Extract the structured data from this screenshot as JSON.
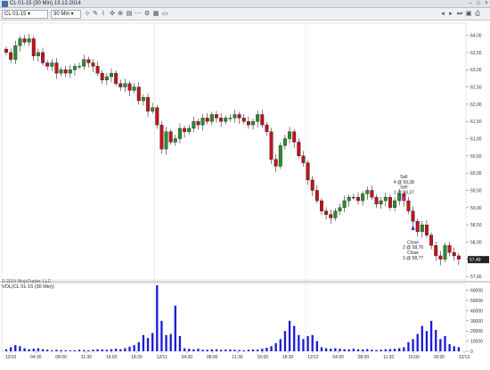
{
  "window": {
    "title": "CL 01-15 (30 Min)  13.12.2014"
  },
  "toolbar": {
    "instrument": "CL 01-15",
    "interval": "30 Min"
  },
  "price_axis": {
    "labels": [
      "64,00",
      "63,50",
      "63,00",
      "62,50",
      "62,00",
      "61,50",
      "61,00",
      "60,50",
      "60,00",
      "59,50",
      "59,00",
      "58,50",
      "58,00",
      "57,50",
      "57,00"
    ],
    "last_price": "57,49"
  },
  "volume_panel": {
    "label": "VOL(CL 01-15 (30 Min))",
    "axis_labels": [
      "60000",
      "50000",
      "40000",
      "30000",
      "20000",
      "10000",
      "0"
    ]
  },
  "copyright": "© 2014 NinjaTrader, LLC",
  "time_axis": {
    "labels": [
      "12/10",
      "04:30",
      "08:00",
      "11:30",
      "16:00",
      "18:30",
      "12/11",
      "04:30",
      "08:00",
      "11:30",
      "16:00",
      "18:30",
      "12/12",
      "04:30",
      "08:00",
      "11:30",
      "16:00",
      "18:30",
      "12/13"
    ]
  },
  "annotations": {
    "sell_top": "Sell",
    "sell_top_detail": "4 @ 59,38",
    "sell_mid": "Sell",
    "sell_mid_detail": "1 @ 59,37",
    "close_1": "Close",
    "close_1_detail": "2 @ 58,76",
    "close_2": "Close",
    "close_2_detail": "3 @ 58,77"
  },
  "colors": {
    "up_candle": "#2e8b2e",
    "down_candle": "#c0141e",
    "volume_bar": "#1a1ad6",
    "sell_marker": "#e010c8",
    "buy_marker": "#1a3ad6",
    "last_price_bg": "#222222"
  },
  "chart_data": {
    "type": "candlestick",
    "price_ylim": [
      56.9,
      64.3
    ],
    "volume_ylim": [
      0,
      65000
    ],
    "closes": [
      63.5,
      63.3,
      63.7,
      63.9,
      63.8,
      63.9,
      63.4,
      63.5,
      63.2,
      63.1,
      63.2,
      62.9,
      63.0,
      62.9,
      63.0,
      63.1,
      63.1,
      63.3,
      63.2,
      63.1,
      62.9,
      62.7,
      62.8,
      62.9,
      62.6,
      62.5,
      62.6,
      62.4,
      62.5,
      62.1,
      62.2,
      61.8,
      61.9,
      61.4,
      60.7,
      61.2,
      60.9,
      61.0,
      61.3,
      61.2,
      61.3,
      61.5,
      61.4,
      61.6,
      61.5,
      61.7,
      61.6,
      61.5,
      61.6,
      61.6,
      61.7,
      61.6,
      61.5,
      61.4,
      61.5,
      61.7,
      61.4,
      61.2,
      60.4,
      60.2,
      60.8,
      61.0,
      61.2,
      60.9,
      60.5,
      60.3,
      59.8,
      59.5,
      59.2,
      58.9,
      58.8,
      58.7,
      58.9,
      59.0,
      59.2,
      59.3,
      59.3,
      59.2,
      59.4,
      59.5,
      59.3,
      59.1,
      59.2,
      59.3,
      59.0,
      59.2,
      59.4,
      59.2,
      58.9,
      58.6,
      58.3,
      58.5,
      58.2,
      57.9,
      57.6,
      57.5,
      57.9,
      57.7,
      57.6,
      57.5
    ],
    "volumes": [
      2000,
      4000,
      6000,
      5000,
      3000,
      2000,
      2500,
      3000,
      2000,
      1500,
      1000,
      1500,
      1200,
      1000,
      800,
      1000,
      1500,
      1200,
      1000,
      1500,
      2000,
      1800,
      1500,
      2000,
      2500,
      2000,
      3000,
      4500,
      6000,
      9000,
      16000,
      13000,
      18000,
      65000,
      30000,
      16000,
      17000,
      45000,
      15000,
      3000,
      2500,
      2000,
      2500,
      1500,
      1500,
      1800,
      2000,
      1500,
      1600,
      1800,
      1500,
      1200,
      1000,
      1500,
      1800,
      1600,
      2500,
      3500,
      5000,
      8000,
      12000,
      20000,
      30000,
      25000,
      16000,
      12000,
      15000,
      16000,
      10000,
      4000,
      3000,
      2500,
      3000,
      2500,
      2000,
      1800,
      2500,
      2000,
      1800,
      2200,
      1500,
      1200,
      1500,
      2000,
      2200,
      2500,
      3000,
      4000,
      9000,
      12000,
      17000,
      25000,
      20000,
      30000,
      21000,
      12000,
      15000,
      7000,
      5000,
      4000
    ]
  }
}
